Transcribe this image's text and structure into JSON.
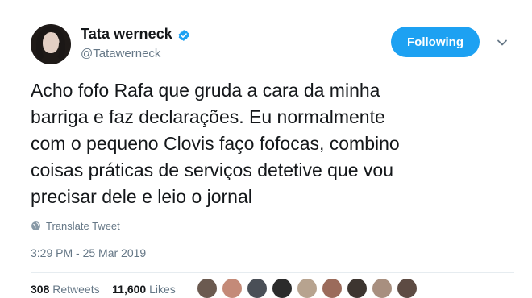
{
  "user": {
    "display_name": "Tata werneck",
    "handle": "@Tatawerneck",
    "verified": true
  },
  "follow_button": {
    "label": "Following"
  },
  "tweet": {
    "text": "Acho fofo Rafa que gruda a cara da minha\nbarriga e faz declarações. Eu normalmente\ncom o pequeno Clovis faço fofocas, combino\ncoisas práticas de serviços detetive que vou\nprecisar dele e leio o jornal",
    "translate_label": "Translate Tweet",
    "timestamp": "3:29 PM - 25 Mar 2019"
  },
  "stats": {
    "retweets_count": "308",
    "retweets_label": "Retweets",
    "likes_count": "11,600",
    "likes_label": "Likes"
  },
  "colors": {
    "accent": "#1da1f2",
    "secondary_text": "#657786"
  },
  "icons": [
    "verified-badge-icon",
    "chevron-down-icon",
    "globe-icon"
  ]
}
